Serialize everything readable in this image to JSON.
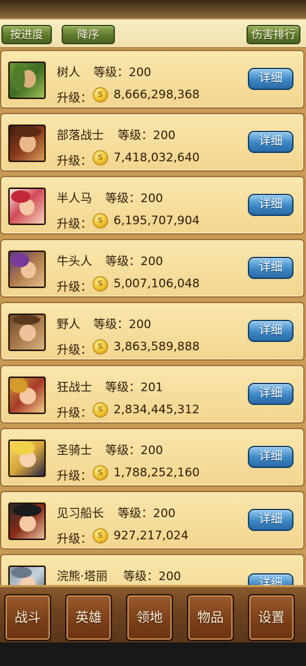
{
  "toolbar": {
    "by_progress": "按进度",
    "descending": "降序",
    "damage_rank": "伤害排行"
  },
  "labels": {
    "level_prefix": "等级：",
    "upgrade_prefix": "升级：",
    "coin_symbol": "S",
    "detail": "详细"
  },
  "heroes": [
    {
      "name": "树人",
      "level": "200",
      "cost": "8,666,298,368"
    },
    {
      "name": "部落战士",
      "level": "200",
      "cost": "7,418,032,640"
    },
    {
      "name": "半人马",
      "level": "200",
      "cost": "6,195,707,904"
    },
    {
      "name": "牛头人",
      "level": "200",
      "cost": "5,007,106,048"
    },
    {
      "name": "野人",
      "level": "200",
      "cost": "3,863,589,888"
    },
    {
      "name": "狂战士",
      "level": "201",
      "cost": "2,834,445,312"
    },
    {
      "name": "圣骑士",
      "level": "200",
      "cost": "1,788,252,160"
    },
    {
      "name": "见习船长",
      "level": "200",
      "cost": "927,217,024"
    },
    {
      "name": "浣熊·塔丽",
      "level": "200",
      "cost": ""
    }
  ],
  "nav": {
    "battle": "战斗",
    "heroes": "英雄",
    "territory": "领地",
    "items": "物品",
    "settings": "设置"
  },
  "colors": {
    "card_bg": "#f6df9e",
    "detail_button": "#3c87c4",
    "toolbar_button": "#5d7a2c",
    "nav_button": "#7a3e18"
  }
}
